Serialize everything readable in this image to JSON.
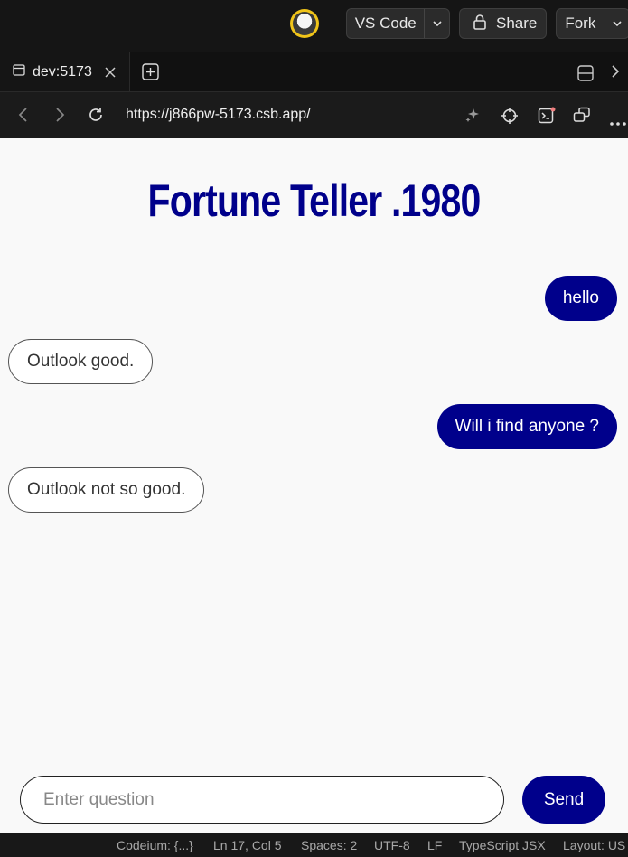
{
  "topbar": {
    "vscode_label": "VS Code",
    "share_label": "Share",
    "fork_label": "Fork"
  },
  "tabs": {
    "active_label": "dev:5173"
  },
  "address": {
    "url": "https://j866pw-5173.csb.app/"
  },
  "app": {
    "title": "Fortune Teller .1980",
    "messages": [
      {
        "role": "user",
        "text": "hello"
      },
      {
        "role": "bot",
        "text": "Outlook good."
      },
      {
        "role": "user",
        "text": "Will i find anyone ?"
      },
      {
        "role": "bot",
        "text": "Outlook not so good."
      }
    ],
    "input_placeholder": "Enter question",
    "input_value": "",
    "send_label": "Send",
    "accent_color": "#00008b"
  },
  "statusbar": {
    "codeium": "Codeium: {...}",
    "position": "Ln 17, Col 5",
    "spaces": "Spaces: 2",
    "encoding": "UTF-8",
    "eol": "LF",
    "language": "TypeScript JSX",
    "layout": "Layout: US"
  },
  "icons": {
    "tab": "browser-tab-icon",
    "close": "close-icon",
    "new_tab": "new-tab-icon",
    "split": "split-view-icon",
    "back": "back-icon",
    "forward": "forward-icon",
    "reload": "reload-icon",
    "sparkle": "sparkle-icon",
    "inspect": "crosshair-icon",
    "terminal": "terminal-icon",
    "popout": "popout-icon",
    "more": "more-icon",
    "lock": "lock-icon"
  }
}
